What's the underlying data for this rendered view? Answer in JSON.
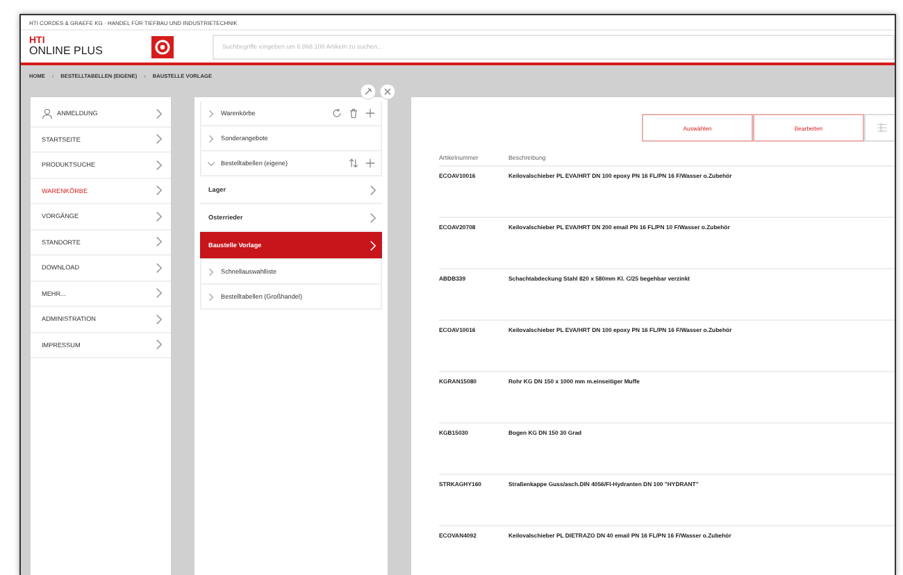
{
  "top_bar": {
    "text": "HTI CORDES & GRAEFE KG · HANDEL FÜR TIEFBAU UND INDUSTRIETECHNIK"
  },
  "header": {
    "logo_line_1": "HTI",
    "logo_line_2": "ONLINE PLUS",
    "search": {
      "placeholder": "Suchbegriffe eingeben um 6.868.108 Artikeln zu suchen..."
    }
  },
  "breadcrumb": [
    "HOME",
    "BESTELLTABELLEN (EIGENE)",
    "BAUSTELLE VORLAGE"
  ],
  "breadcrumb_separator": "›",
  "sidebar": {
    "items": [
      {
        "label": "ANMELDUNG",
        "kind": "user",
        "selected": false
      },
      {
        "label": "STARTSEITE",
        "kind": "plain",
        "selected": false
      },
      {
        "label": "PRODUKTSUCHE",
        "kind": "plain",
        "selected": false
      },
      {
        "label": "WARENKÖRBE",
        "kind": "plain",
        "selected": true
      },
      {
        "label": "VORGÄNGE",
        "kind": "plain",
        "selected": false
      },
      {
        "label": "STANDORTE",
        "kind": "plain",
        "selected": false
      },
      {
        "label": "DOWNLOAD",
        "kind": "plain",
        "selected": false
      },
      {
        "label": "MEHR...",
        "kind": "plain",
        "selected": false
      },
      {
        "label": "ADMINISTRATION",
        "kind": "plain",
        "selected": false
      },
      {
        "label": "IMPRESSUM",
        "kind": "plain",
        "selected": false
      }
    ]
  },
  "folders": [
    {
      "label": "Warenkörbe",
      "expanded": false,
      "actions": [
        {
          "kind": "refresh"
        },
        {
          "kind": "trash"
        },
        {
          "kind": "add"
        }
      ]
    },
    {
      "label": "Sonderangebote",
      "expanded": false
    },
    {
      "label": "Bestelltabellen (eigene)",
      "expanded": true,
      "actions": [
        {
          "kind": "sort"
        },
        {
          "kind": "add"
        }
      ],
      "children": [
        {
          "label": "Lager",
          "selected": false
        },
        {
          "label": "Osterrieder",
          "selected": false
        },
        {
          "label": "Baustelle Vorlage",
          "selected": true
        }
      ]
    },
    {
      "label": "Schnellauswahlliste",
      "expanded": false
    },
    {
      "label": "Bestelltabellen (Großhandel)",
      "expanded": false
    }
  ],
  "toolbar": {
    "buttons": [
      "Auswählen",
      "Bearbeiten"
    ]
  },
  "table": {
    "columns": [
      "Artikelnummer",
      "Beschreibung"
    ],
    "rows": [
      [
        "ECOAV10016",
        "Keilovalschieber PL EVA/HRT DN 100 epoxy PN 16 FL/PN 16 F/Wasser o.Zubehör"
      ],
      [
        "ECOAV20708",
        "Keilovalschieber PL EVA/HRT DN 200 email PN 16 FL/PN 10 F/Wasser o.Zubehör"
      ],
      [
        "ABDB339",
        "Schachtabdeckung Stahl 820 x 580mm Kl. C/25 begehbar verzinkt"
      ],
      [
        "ECOAV10016",
        "Keilovalschieber PL EVA/HRT DN 100 epoxy PN 16 FL/PN 16 F/Wasser o.Zubehör"
      ],
      [
        "KGRAN15080",
        "Rohr KG DN 150 x 1000 mm m.einseitiger Muffe"
      ],
      [
        "KGB15030",
        "Bogen KG DN 150 30 Grad"
      ],
      [
        "STRKAGHY160",
        "Straßenkappe Guss/asch.DIN 4056/Fl-Hydranten DN 100 \"HYDRANT\""
      ],
      [
        "ECOVAN4092",
        "Keilovalschieber PL DIETRAZO DN 40 email PN 16 FL/PN 16 F/Wasser o.Zubehör"
      ]
    ]
  }
}
